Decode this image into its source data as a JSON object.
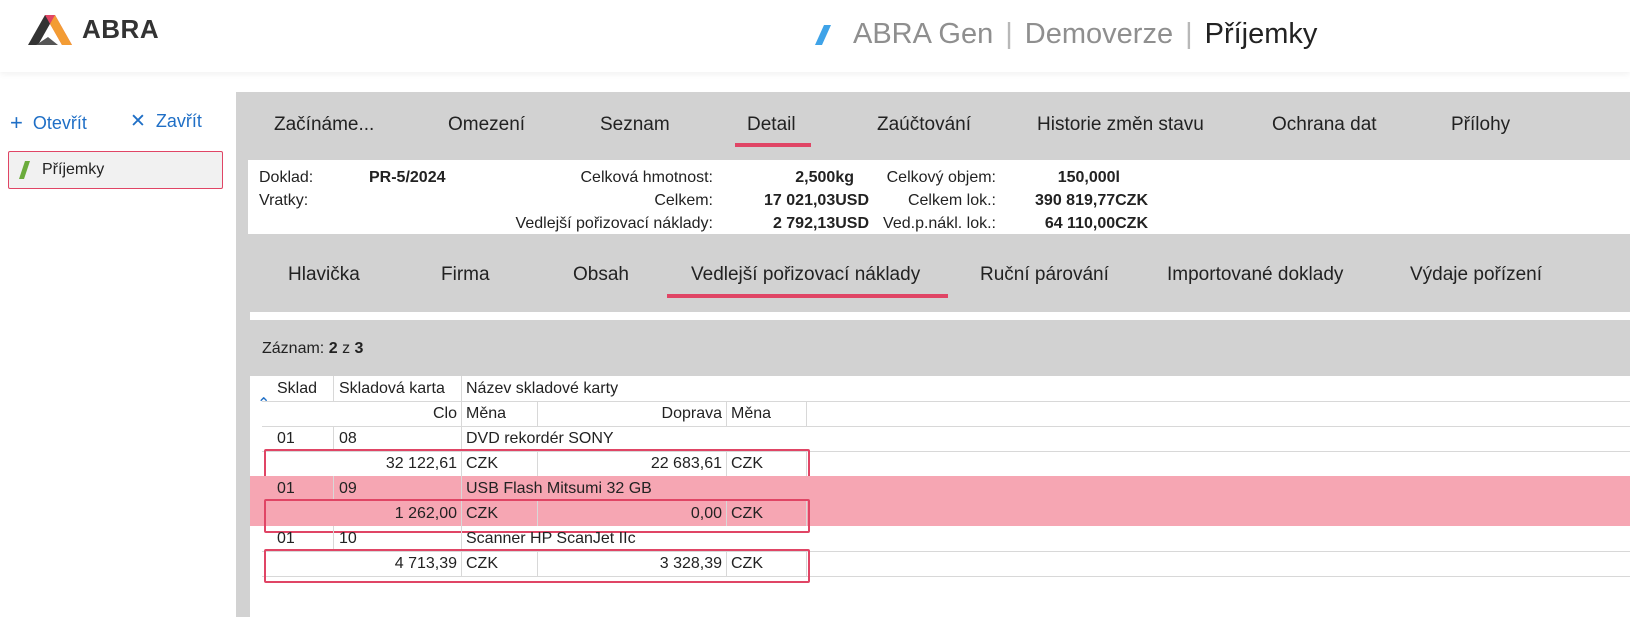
{
  "brand": {
    "logo_text": "ABRA",
    "accent": "#e04565",
    "link_color": "#1f6fc6"
  },
  "header": {
    "app": "ABRA Gen",
    "separator": "|",
    "edition": "Demoverze",
    "page": "Příjemky"
  },
  "leftnav": {
    "open_label": "Otevřít",
    "close_label": "Zavřít",
    "tab_label": "Příjemky"
  },
  "main_tabs": [
    "Začínáme...",
    "Omezení",
    "Seznam",
    "Detail",
    "Zaúčtování",
    "Historie změn stavu",
    "Ochrana dat",
    "Přílohy"
  ],
  "main_tabs_active": "Detail",
  "info": {
    "doklad_label": "Doklad:",
    "doklad_value": "PR-5/2024",
    "vratky_label": "Vratky:",
    "hmotnost_label": "Celková hmotnost:",
    "hmotnost_value": "2,500kg",
    "objem_label": "Celkový objem:",
    "objem_value": "150,000l",
    "celkem_label": "Celkem:",
    "celkem_value": "17 021,03USD",
    "celkem_lok_label": "Celkem lok.:",
    "celkem_lok_value": "390 819,77CZK",
    "vpn_label": "Vedlejší pořizovací náklady:",
    "vpn_value": "2 792,13USD",
    "vpn_lok_label": "Ved.p.nákl. lok.:",
    "vpn_lok_value": "64 110,00CZK"
  },
  "sub_tabs": [
    "Hlavička",
    "Firma",
    "Obsah",
    "Vedlejší pořizovací náklady",
    "Ruční párování",
    "Importované doklady",
    "Výdaje pořízení"
  ],
  "sub_tabs_active": "Vedlejší pořizovací náklady",
  "record": {
    "label": "Záznam:",
    "current": "2",
    "of": "z",
    "total": "3"
  },
  "grid": {
    "headers_row1": [
      "Sklad",
      "Skladová karta",
      "Název skladové karty"
    ],
    "headers_row2": [
      "Clo",
      "Měna",
      "Doprava",
      "Měna"
    ],
    "rows": [
      {
        "sklad": "01",
        "karta": "08",
        "nazev": "DVD rekordér SONY",
        "clo": "32 122,61",
        "mena1": "CZK",
        "doprava": "22 683,61",
        "mena2": "CZK",
        "selected": false
      },
      {
        "sklad": "01",
        "karta": "09",
        "nazev": "USB Flash Mitsumi 32 GB",
        "clo": "1 262,00",
        "mena1": "CZK",
        "doprava": "0,00",
        "mena2": "CZK",
        "selected": true
      },
      {
        "sklad": "01",
        "karta": "10",
        "nazev": "Scanner HP ScanJet IIc",
        "clo": "4 713,39",
        "mena1": "CZK",
        "doprava": "3 328,39",
        "mena2": "CZK",
        "selected": false
      }
    ]
  }
}
